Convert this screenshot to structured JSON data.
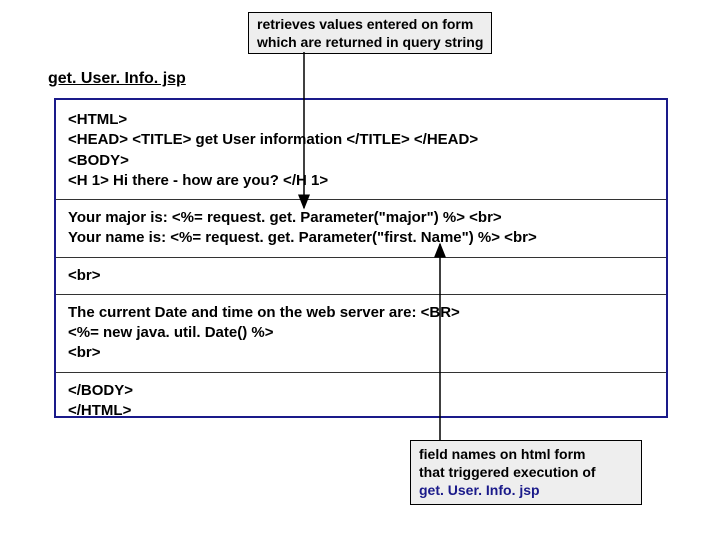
{
  "callout_top": {
    "line1": "retrieves values entered on form",
    "line2": "which are returned in query string"
  },
  "filename": "get. User. Info. jsp",
  "code": {
    "l1": "<HTML>",
    "l2": "<HEAD> <TITLE>   get User information  </TITLE> </HEAD>",
    "l3": "<BODY>",
    "l4": "<H 1> Hi there - how are you?  </H 1>",
    "l5a": "Your major is:  ",
    "l5b": "<%=  request. get. Parameter(\"major\")        %>  <br>",
    "l6a": "Your name is:  ",
    "l6b": "<%=  request. get. Parameter(\"first. Name\")  %>  <br>",
    "l7": "<br>",
    "l8": "The current Date and time on the web server are: <BR>",
    "l9": "<%= new   java. util. Date() %>",
    "l10": "<br>",
    "l11": "</BODY>",
    "l12": "</HTML>"
  },
  "callout_bottom": {
    "line1": "field names on html form",
    "line2": "that triggered execution of",
    "filename": "get. User. Info. jsp"
  }
}
